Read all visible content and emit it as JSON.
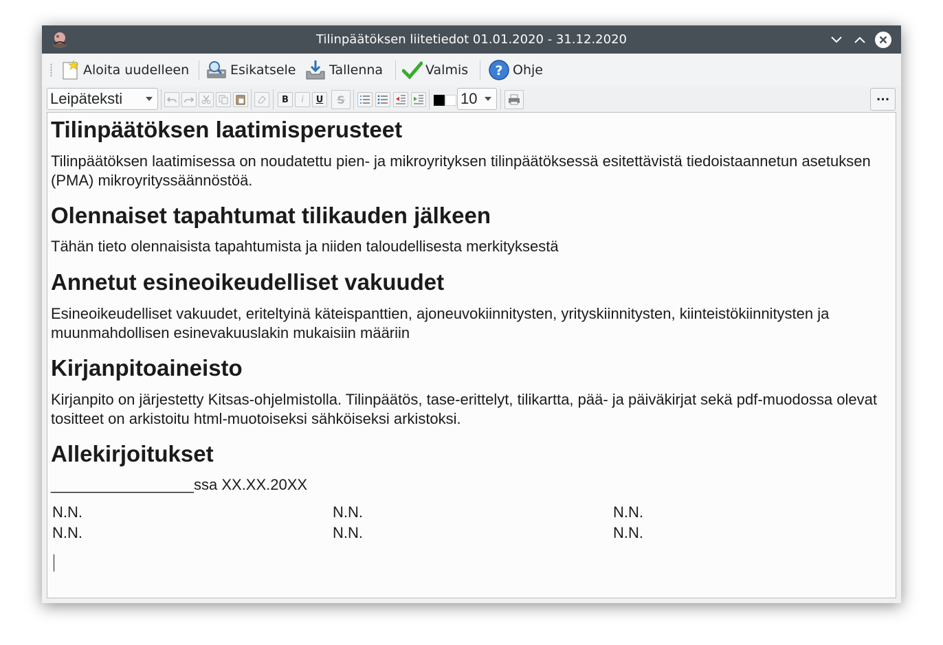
{
  "window": {
    "title": "Tilinpäätöksen liitetiedot 01.01.2020 - 31.12.2020"
  },
  "toolbar": {
    "restart_label": "Aloita uudelleen",
    "preview_label": "Esikatsele",
    "save_label": "Tallenna",
    "done_label": "Valmis",
    "help_label": "Ohje"
  },
  "format_toolbar": {
    "paragraph_style": "Leipäteksti",
    "font_size": "10",
    "more_label": "...",
    "bold_glyph": "B",
    "italic_glyph": "i",
    "underline_glyph": "U",
    "strike_glyph": "S",
    "text_color": "#000000",
    "background_color": "#ffffff"
  },
  "document": {
    "sections": [
      {
        "heading": "Tilinpäätöksen laatimisperusteet",
        "body": "Tilinpäätöksen laatimisessa on noudatettu pien- ja mikroyrityksen tilinpäätöksessä esitettävistä tiedoistaannetun asetuksen (PMA) mikroyrityssäännöstöä."
      },
      {
        "heading": "Olennaiset tapahtumat tilikauden jälkeen",
        "body": "Tähän tieto olennaisista tapahtumista ja niiden taloudellisesta merkityksestä"
      },
      {
        "heading": "Annetut esineoikeudelliset vakuudet",
        "body": "Esineoikeudelliset vakuudet, eriteltyinä käteispanttien, ajoneuvokiinnitysten, yrityskiinnitysten, kiinteistökiinnitysten ja muunmahdollisen esinevakuuslakin mukaisiin määriin"
      },
      {
        "heading": "Kirjanpitoaineisto",
        "body": "Kirjanpito on järjestetty Kitsas-ohjelmistolla. Tilinpäätös, tase-erittelyt, tilikartta, pää- ja päiväkirjat sekä pdf-muodossa olevat tositteet on arkistoitu html-muotoiseksi sähköiseksi arkistoksi."
      },
      {
        "heading": "Allekirjoitukset"
      }
    ],
    "place_date": "_________________ssa XX.XX.20XX",
    "signatures": [
      [
        "N.N.",
        "N.N.",
        "N.N."
      ],
      [
        "N.N.",
        "N.N.",
        "N.N."
      ]
    ]
  },
  "icons": {
    "app": "kitsas-app-icon",
    "restart": "new-document-star-icon",
    "preview": "magnifier-preview-icon",
    "save": "save-tray-icon",
    "done": "green-checkmark-icon",
    "help": "question-circle-icon"
  }
}
